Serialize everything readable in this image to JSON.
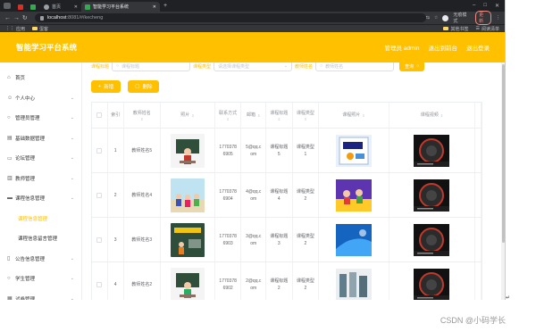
{
  "browser": {
    "tabs": [
      {
        "label": ""
      },
      {
        "label": ""
      },
      {
        "label": "首页"
      },
      {
        "label": "智能学习平台系统"
      }
    ],
    "window_controls": [
      "–",
      "□",
      "✕"
    ],
    "url": {
      "host": "localhost",
      "path": ":8081/#/kecheng"
    },
    "incognito_label": "无痕模式",
    "update_label": "更新",
    "bookmarks": [
      {
        "label": "应用"
      },
      {
        "label": "蛋客"
      }
    ],
    "bookmarks_right": [
      {
        "label": "其他书签"
      },
      {
        "label": "阅读清单"
      }
    ]
  },
  "header": {
    "title": "智能学习平台系统",
    "links": [
      "管理员 admin",
      "退出到前台",
      "退出登录"
    ]
  },
  "sidebar": {
    "items": [
      {
        "label": "首页",
        "icon": "home-icon",
        "arrow": false,
        "sub": false
      },
      {
        "label": "个人中心",
        "icon": "user-icon",
        "arrow": true,
        "sub": false
      },
      {
        "label": "管理员管理",
        "icon": "bulb-icon",
        "arrow": true,
        "sub": false
      },
      {
        "label": "基础数据管理",
        "icon": "grid-icon",
        "arrow": true,
        "sub": false
      },
      {
        "label": "论坛管理",
        "icon": "chat-icon",
        "arrow": true,
        "sub": false
      },
      {
        "label": "教师管理",
        "icon": "chart-icon",
        "arrow": true,
        "sub": false
      },
      {
        "label": "课程信息管理",
        "icon": "book-icon",
        "arrow": true,
        "sub": false
      },
      {
        "label": "课程信息管理",
        "icon": "",
        "arrow": false,
        "sub": true,
        "active": true
      },
      {
        "label": "课程信息留言管理",
        "icon": "",
        "arrow": false,
        "sub": true
      },
      {
        "label": "公告信息管理",
        "icon": "doc-icon",
        "arrow": true,
        "sub": false
      },
      {
        "label": "学生管理",
        "icon": "bulb-icon",
        "arrow": true,
        "sub": false
      },
      {
        "label": "试卷管理",
        "icon": "list-icon",
        "arrow": true,
        "sub": false
      }
    ]
  },
  "search": {
    "label1": "课程标题",
    "placeholder1": "课程标题",
    "label2": "课程类型",
    "placeholder2": "请选择课程类型",
    "label3": "教师姓名",
    "placeholder3": "教师姓名",
    "button": "查询"
  },
  "actions": {
    "add": "新增",
    "delete": "删除"
  },
  "table": {
    "headers": [
      "索引",
      "教师姓名",
      "照片",
      "联系方式",
      "邮箱",
      "课程标题",
      "课程类型",
      "课程照片",
      "课程视频"
    ],
    "rows": [
      {
        "index": "1",
        "name": "教师姓名5",
        "phone": "17703786905",
        "email": "5@qq.com",
        "title": "课程标题5",
        "type": "课程类型1"
      },
      {
        "index": "2",
        "name": "教师姓名4",
        "phone": "17703786904",
        "email": "4@qq.com",
        "title": "课程标题4",
        "type": "课程类型2"
      },
      {
        "index": "3",
        "name": "教师姓名3",
        "phone": "17703786903",
        "email": "3@qq.com",
        "title": "课程标题3",
        "type": "课程类型2"
      },
      {
        "index": "4",
        "name": "教师姓名2",
        "phone": "17703786902",
        "email": "2@qq.com",
        "title": "课程标题2",
        "type": "课程类型2"
      }
    ]
  },
  "watermark": "CSDN @小码学长",
  "colors": {
    "brand": "#ffc000",
    "text": "#606266"
  }
}
